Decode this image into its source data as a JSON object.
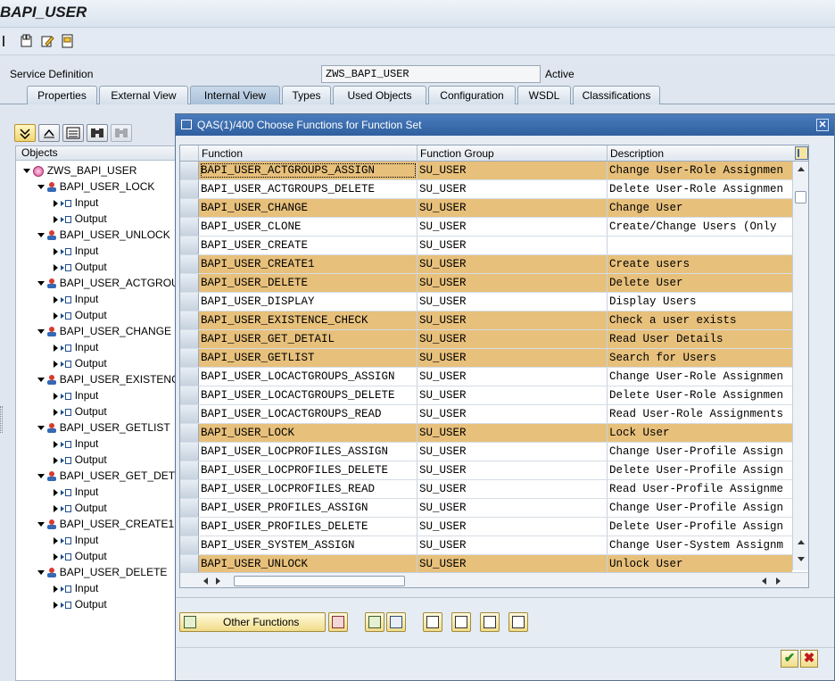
{
  "window": {
    "title": "BAPI_USER"
  },
  "toolbar": {
    "icons": [
      "display-change-icon",
      "edit-icon",
      "info-icon"
    ]
  },
  "service_definition": {
    "label": "Service Definition",
    "value": "ZWS_BAPI_USER",
    "status": "Active"
  },
  "tabs": [
    {
      "label": "Properties"
    },
    {
      "label": "External View"
    },
    {
      "label": "Internal View",
      "active": true
    },
    {
      "label": "Types"
    },
    {
      "label": "Used Objects"
    },
    {
      "label": "Configuration"
    },
    {
      "label": "WSDL"
    },
    {
      "label": "Classifications"
    }
  ],
  "tree": {
    "header": "Objects",
    "root": "ZWS_BAPI_USER",
    "input_label": "Input",
    "output_label": "Output",
    "functions": [
      "BAPI_USER_LOCK",
      "BAPI_USER_UNLOCK",
      "BAPI_USER_ACTGROU",
      "BAPI_USER_CHANGE",
      "BAPI_USER_EXISTENC",
      "BAPI_USER_GETLIST",
      "BAPI_USER_GET_DET",
      "BAPI_USER_CREATE1",
      "BAPI_USER_DELETE"
    ]
  },
  "dialog": {
    "title": "QAS(1)/400 Choose Functions for Function Set",
    "columns": {
      "function": "Function",
      "group": "Function Group",
      "description": "Description"
    },
    "rows": [
      {
        "function": "BAPI_USER_ACTGROUPS_ASSIGN",
        "group": "SU_USER",
        "description": "Change User-Role Assignmen",
        "selected": true
      },
      {
        "function": "BAPI_USER_ACTGROUPS_DELETE",
        "group": "SU_USER",
        "description": "Delete User-Role Assignmen",
        "selected": false
      },
      {
        "function": "BAPI_USER_CHANGE",
        "group": "SU_USER",
        "description": "Change User",
        "selected": true
      },
      {
        "function": "BAPI_USER_CLONE",
        "group": "SU_USER",
        "description": "Create/Change Users (Only",
        "selected": false
      },
      {
        "function": "BAPI_USER_CREATE",
        "group": "SU_USER",
        "description": "",
        "selected": false
      },
      {
        "function": "BAPI_USER_CREATE1",
        "group": "SU_USER",
        "description": "Create users",
        "selected": true
      },
      {
        "function": "BAPI_USER_DELETE",
        "group": "SU_USER",
        "description": "Delete User",
        "selected": true
      },
      {
        "function": "BAPI_USER_DISPLAY",
        "group": "SU_USER",
        "description": "Display Users",
        "selected": false
      },
      {
        "function": "BAPI_USER_EXISTENCE_CHECK",
        "group": "SU_USER",
        "description": "Check a user exists",
        "selected": true
      },
      {
        "function": "BAPI_USER_GET_DETAIL",
        "group": "SU_USER",
        "description": "Read User Details",
        "selected": true
      },
      {
        "function": "BAPI_USER_GETLIST",
        "group": "SU_USER",
        "description": "Search for Users",
        "selected": true
      },
      {
        "function": "BAPI_USER_LOCACTGROUPS_ASSIGN",
        "group": "SU_USER",
        "description": "Change User-Role Assignmen",
        "selected": false
      },
      {
        "function": "BAPI_USER_LOCACTGROUPS_DELETE",
        "group": "SU_USER",
        "description": "Delete User-Role Assignmen",
        "selected": false
      },
      {
        "function": "BAPI_USER_LOCACTGROUPS_READ",
        "group": "SU_USER",
        "description": "Read User-Role Assignments",
        "selected": false
      },
      {
        "function": "BAPI_USER_LOCK",
        "group": "SU_USER",
        "description": "Lock User",
        "selected": true
      },
      {
        "function": "BAPI_USER_LOCPROFILES_ASSIGN",
        "group": "SU_USER",
        "description": "Change User-Profile Assign",
        "selected": false
      },
      {
        "function": "BAPI_USER_LOCPROFILES_DELETE",
        "group": "SU_USER",
        "description": "Delete User-Profile Assign",
        "selected": false
      },
      {
        "function": "BAPI_USER_LOCPROFILES_READ",
        "group": "SU_USER",
        "description": "Read User-Profile Assignme",
        "selected": false
      },
      {
        "function": "BAPI_USER_PROFILES_ASSIGN",
        "group": "SU_USER",
        "description": "Change User-Profile Assign",
        "selected": false
      },
      {
        "function": "BAPI_USER_PROFILES_DELETE",
        "group": "SU_USER",
        "description": "Delete User-Profile Assign",
        "selected": false
      },
      {
        "function": "BAPI_USER_SYSTEM_ASSIGN",
        "group": "SU_USER",
        "description": "Change User-System Assignm",
        "selected": false
      },
      {
        "function": "BAPI_USER_UNLOCK",
        "group": "SU_USER",
        "description": "Unlock User",
        "selected": true
      }
    ],
    "other_functions_label": "Other Functions",
    "highlight_color": "#e7c07b"
  }
}
